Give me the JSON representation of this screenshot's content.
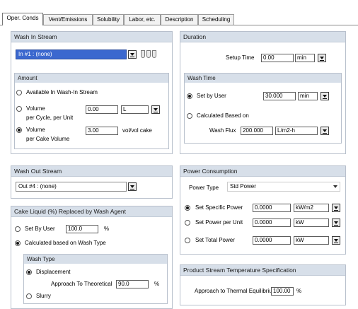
{
  "tabs": [
    "Oper. Conds",
    "Vent/Emissions",
    "Solubility",
    "Labor, etc.",
    "Description",
    "Scheduling"
  ],
  "wash_in": {
    "header": "Wash In Stream",
    "stream": "In #1 : (none)",
    "amount_header": "Amount",
    "opt_available": "Available In Wash-In Stream",
    "opt_volume_cycle_line1": "Volume",
    "opt_volume_cycle_line2": "per Cycle, per Unit",
    "volume_cycle_value": "0.00",
    "volume_cycle_unit": "L",
    "opt_volume_cake_line1": "Volume",
    "opt_volume_cake_line2": "per Cake Volume",
    "volume_cake_value": "3.00",
    "volume_cake_unit": "vol/vol cake"
  },
  "duration": {
    "header": "Duration",
    "setup_label": "Setup Time",
    "setup_value": "0.00",
    "setup_unit": "min",
    "wash_time_header": "Wash Time",
    "opt_set_by_user": "Set by User",
    "set_by_user_value": "30.000",
    "set_by_user_unit": "min",
    "opt_calculated": "Calculated Based on",
    "wash_flux_label": "Wash Flux",
    "wash_flux_value": "200.000",
    "wash_flux_unit": "L/m2-h"
  },
  "wash_out": {
    "header": "Wash Out Stream",
    "stream": "Out #4 : (none)"
  },
  "cake_liquid": {
    "header": "Cake Liquid (%) Replaced by Wash Agent",
    "opt_set_by_user": "Set By User",
    "set_by_user_value": "100.0",
    "set_by_user_unit": "%",
    "opt_calculated": "Calculated based on Wash Type",
    "wash_type_header": "Wash Type",
    "opt_displacement": "Displacement",
    "approach_label": "Approach To Theoretical",
    "approach_value": "90.0",
    "approach_unit": "%",
    "opt_slurry": "Slurry"
  },
  "power": {
    "header": "Power Consumption",
    "power_type_label": "Power Type",
    "power_type_value": "Std Power",
    "opt_specific": "Set Specific Power",
    "specific_value": "0.0000",
    "specific_unit": "kW/m2",
    "opt_per_unit": "Set Power per Unit",
    "per_unit_value": "0.0000",
    "per_unit_unit": "kW",
    "opt_total": "Set Total Power",
    "total_value": "0.0000",
    "total_unit": "kW"
  },
  "temperature": {
    "header": "Product Stream Temperature Specification",
    "approach_label": "Approach to Thermal Equilibrium",
    "approach_value": "100.00",
    "approach_unit": "%"
  }
}
